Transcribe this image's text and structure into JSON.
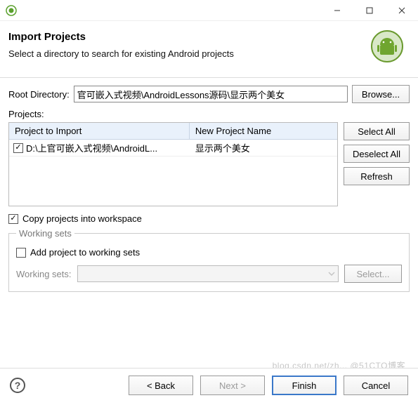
{
  "header": {
    "title": "Import Projects",
    "subtitle": "Select a directory to search for existing Android projects"
  },
  "rootDir": {
    "label": "Root Directory:",
    "value": "官可嵌入式视频\\AndroidLessons源码\\显示两个美女",
    "browse": "Browse..."
  },
  "projects": {
    "label": "Projects:",
    "col1": "Project to Import",
    "col2": "New Project Name",
    "rows": [
      {
        "checked": true,
        "path": "D:\\上官可嵌入式视频\\AndroidL...",
        "name": "显示两个美女"
      }
    ],
    "selectAll": "Select All",
    "deselectAll": "Deselect All",
    "refresh": "Refresh"
  },
  "copyCheckbox": {
    "checked": true,
    "label": "Copy projects into workspace"
  },
  "workingSets": {
    "legend": "Working sets",
    "addLabel": "Add project to working sets",
    "addChecked": false,
    "comboLabel": "Working sets:",
    "selectBtn": "Select..."
  },
  "footer": {
    "back": "< Back",
    "next": "Next >",
    "finish": "Finish",
    "cancel": "Cancel"
  },
  "watermark": "blog.csdn.net/zh... @51CTO博客"
}
